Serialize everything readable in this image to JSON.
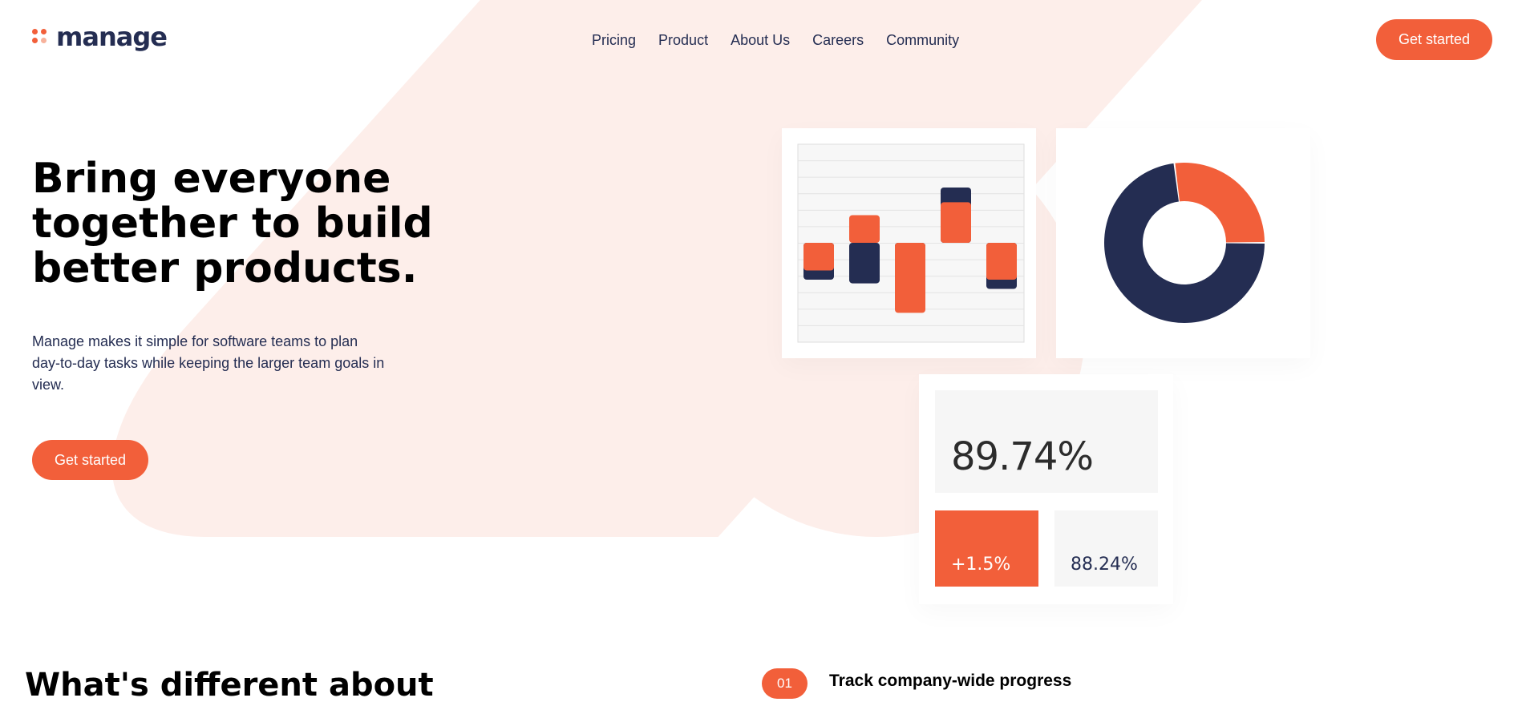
{
  "brand": {
    "name": "manage",
    "accent": "#f25f3a",
    "dark": "#242d52",
    "blob": "#fdeeea"
  },
  "nav": {
    "items": [
      "Pricing",
      "Product",
      "About Us",
      "Careers",
      "Community"
    ]
  },
  "header": {
    "cta_label": "Get started"
  },
  "hero": {
    "title": "Bring everyone together to build better products.",
    "description": "Manage makes it simple for software teams to plan day-to-day tasks while keeping the larger team goals in view.",
    "cta_label": "Get started"
  },
  "stats": {
    "main": "89.74%",
    "change": "+1.5%",
    "secondary": "88.24%"
  },
  "section": {
    "title": "What's different about",
    "feature_number": "01",
    "feature_title": "Track company-wide progress"
  },
  "chart_data": [
    {
      "type": "bar",
      "title": "",
      "grid": true,
      "series": [
        {
          "color": "#242d52",
          "values": [
            -2,
            -2.2,
            -1.5,
            3,
            -2.5
          ]
        },
        {
          "color": "#f25f3a",
          "values": [
            -1.5,
            1.5,
            -3.8,
            2.2,
            -2
          ]
        }
      ]
    },
    {
      "type": "pie",
      "donut": true,
      "title": "",
      "slices": [
        {
          "value": 0.73,
          "color": "#242d52"
        },
        {
          "value": 0.27,
          "color": "#f25f3a"
        }
      ]
    }
  ]
}
